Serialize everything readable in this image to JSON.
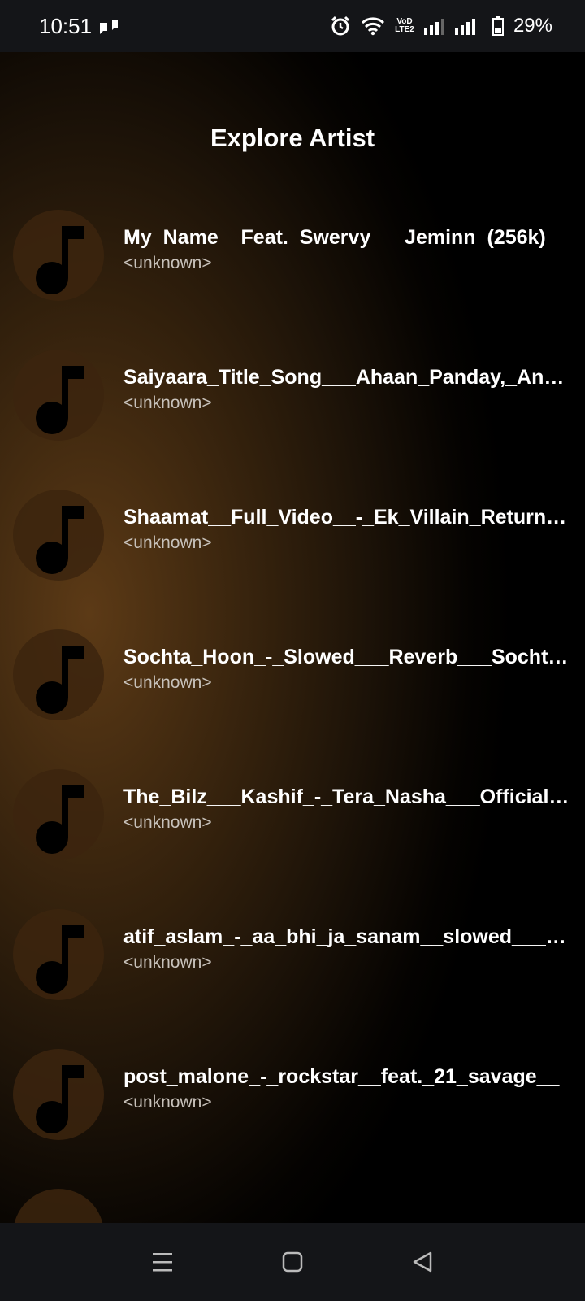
{
  "status_bar": {
    "time": "10:51",
    "battery": "29%",
    "network_badge": "VoD LTE2",
    "icons": [
      "signal-app-icon",
      "alarm-icon",
      "wifi-icon",
      "cell-signal-icon",
      "battery-icon"
    ]
  },
  "page": {
    "title": "Explore Artist",
    "accent_color": "#5c3a16"
  },
  "songs": [
    {
      "title": "My_Name__Feat._Swervy___Jeminn_(256k)",
      "artist": "<unknown>",
      "icon": "music-note-icon"
    },
    {
      "title": "Saiyaara_Title_Song___Ahaan_Panday,_Aneet_Padda",
      "artist": "<unknown>",
      "icon": "music-note-icon"
    },
    {
      "title": "Shaamat__Full_Video__-_Ek_Villain_Returns_John",
      "artist": "<unknown>",
      "icon": "music-note-icon"
    },
    {
      "title": "Sochta_Hoon_-_Slowed___Reverb___Sochta_Hoon",
      "artist": "<unknown>",
      "icon": "music-note-icon"
    },
    {
      "title": "The_Bilz___Kashif_-_Tera_Nasha___Official_Video",
      "artist": "<unknown>",
      "icon": "music-note-icon"
    },
    {
      "title": "atif_aslam_-_aa_bhi_ja_sanam__slowed___reverb",
      "artist": "<unknown>",
      "icon": "music-note-icon"
    },
    {
      "title": "post_malone_-_rockstar__feat._21_savage__",
      "artist": "<unknown>",
      "icon": "music-note-icon"
    }
  ],
  "nav_bar": {
    "buttons": [
      "menu-icon",
      "home-icon",
      "back-icon"
    ]
  }
}
